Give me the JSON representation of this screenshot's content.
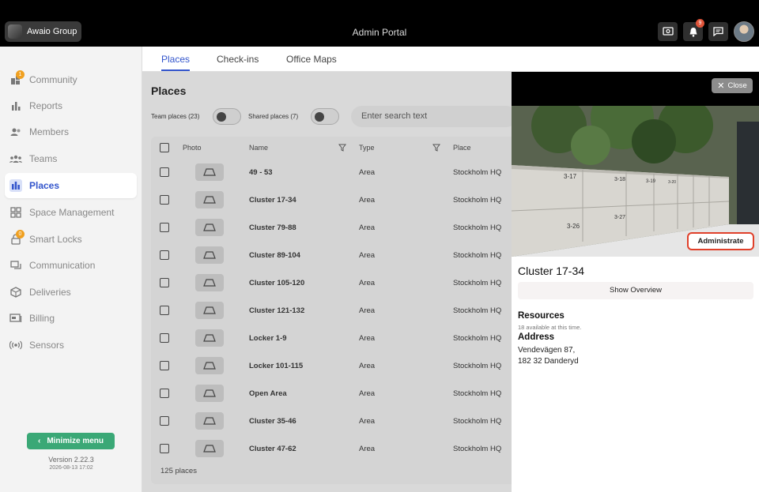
{
  "header": {
    "org_name": "Awaio Group",
    "portal_title": "Admin Portal",
    "notification_count": "9",
    "icons": [
      "screen-share-icon",
      "bell-icon",
      "chat-icon"
    ]
  },
  "sidebar": {
    "items": [
      {
        "label": "Community",
        "icon": "community-icon",
        "badge": "1"
      },
      {
        "label": "Reports",
        "icon": "bar-chart-icon"
      },
      {
        "label": "Members",
        "icon": "members-icon"
      },
      {
        "label": "Teams",
        "icon": "teams-icon"
      },
      {
        "label": "Places",
        "icon": "places-icon"
      },
      {
        "label": "Space Management",
        "icon": "grid-icon"
      },
      {
        "label": "Smart Locks",
        "icon": "lock-icon",
        "badge": "0"
      },
      {
        "label": "Communication",
        "icon": "communication-icon"
      },
      {
        "label": "Deliveries",
        "icon": "box-icon"
      },
      {
        "label": "Billing",
        "icon": "billing-icon"
      },
      {
        "label": "Sensors",
        "icon": "sensor-icon"
      }
    ],
    "active": "Places",
    "minimize_label": "Minimize menu",
    "version": "Version 2.22.3",
    "version_date": "2026-08-13 17:02"
  },
  "tabs": [
    "Places",
    "Check-ins",
    "Office Maps"
  ],
  "places": {
    "title": "Places",
    "team_places_label": "Team places (23)",
    "shared_places_label": "Shared places (7)",
    "search_placeholder": "Enter search text",
    "columns": [
      "Photo",
      "Name",
      "Type",
      "Place"
    ],
    "rows": [
      {
        "name": "49 - 53",
        "type": "Area",
        "place": "Stockholm HQ"
      },
      {
        "name": "Cluster 17-34",
        "type": "Area",
        "place": "Stockholm HQ"
      },
      {
        "name": "Cluster 79-88",
        "type": "Area",
        "place": "Stockholm HQ"
      },
      {
        "name": "Cluster 89-104",
        "type": "Area",
        "place": "Stockholm HQ"
      },
      {
        "name": "Cluster 105-120",
        "type": "Area",
        "place": "Stockholm HQ"
      },
      {
        "name": "Cluster 121-132",
        "type": "Area",
        "place": "Stockholm HQ"
      },
      {
        "name": "Locker 1-9",
        "type": "Area",
        "place": "Stockholm HQ"
      },
      {
        "name": "Locker 101-115",
        "type": "Area",
        "place": "Stockholm HQ"
      },
      {
        "name": "Open Area",
        "type": "Area",
        "place": "Stockholm HQ"
      },
      {
        "name": "Cluster 35-46",
        "type": "Area",
        "place": "Stockholm HQ"
      },
      {
        "name": "Cluster 47-62",
        "type": "Area",
        "place": "Stockholm HQ"
      }
    ],
    "count_label": "125 places"
  },
  "detail": {
    "close_label": "Close",
    "administrate_label": "Administrate",
    "title": "Cluster 17-34",
    "show_overview_label": "Show Overview",
    "resources_heading": "Resources",
    "resources_sub": "18 available at this time.",
    "address_heading": "Address",
    "address_line1": "Vendevägen 87,",
    "address_line2": "182 32 Danderyd",
    "locker_labels": [
      "3-17",
      "3-18",
      "3-19",
      "3-20",
      "3-27",
      "3-26"
    ]
  },
  "colors": {
    "accent": "#3355cc",
    "minimize_green": "#3aa876",
    "highlight_red": "#e0402a"
  }
}
